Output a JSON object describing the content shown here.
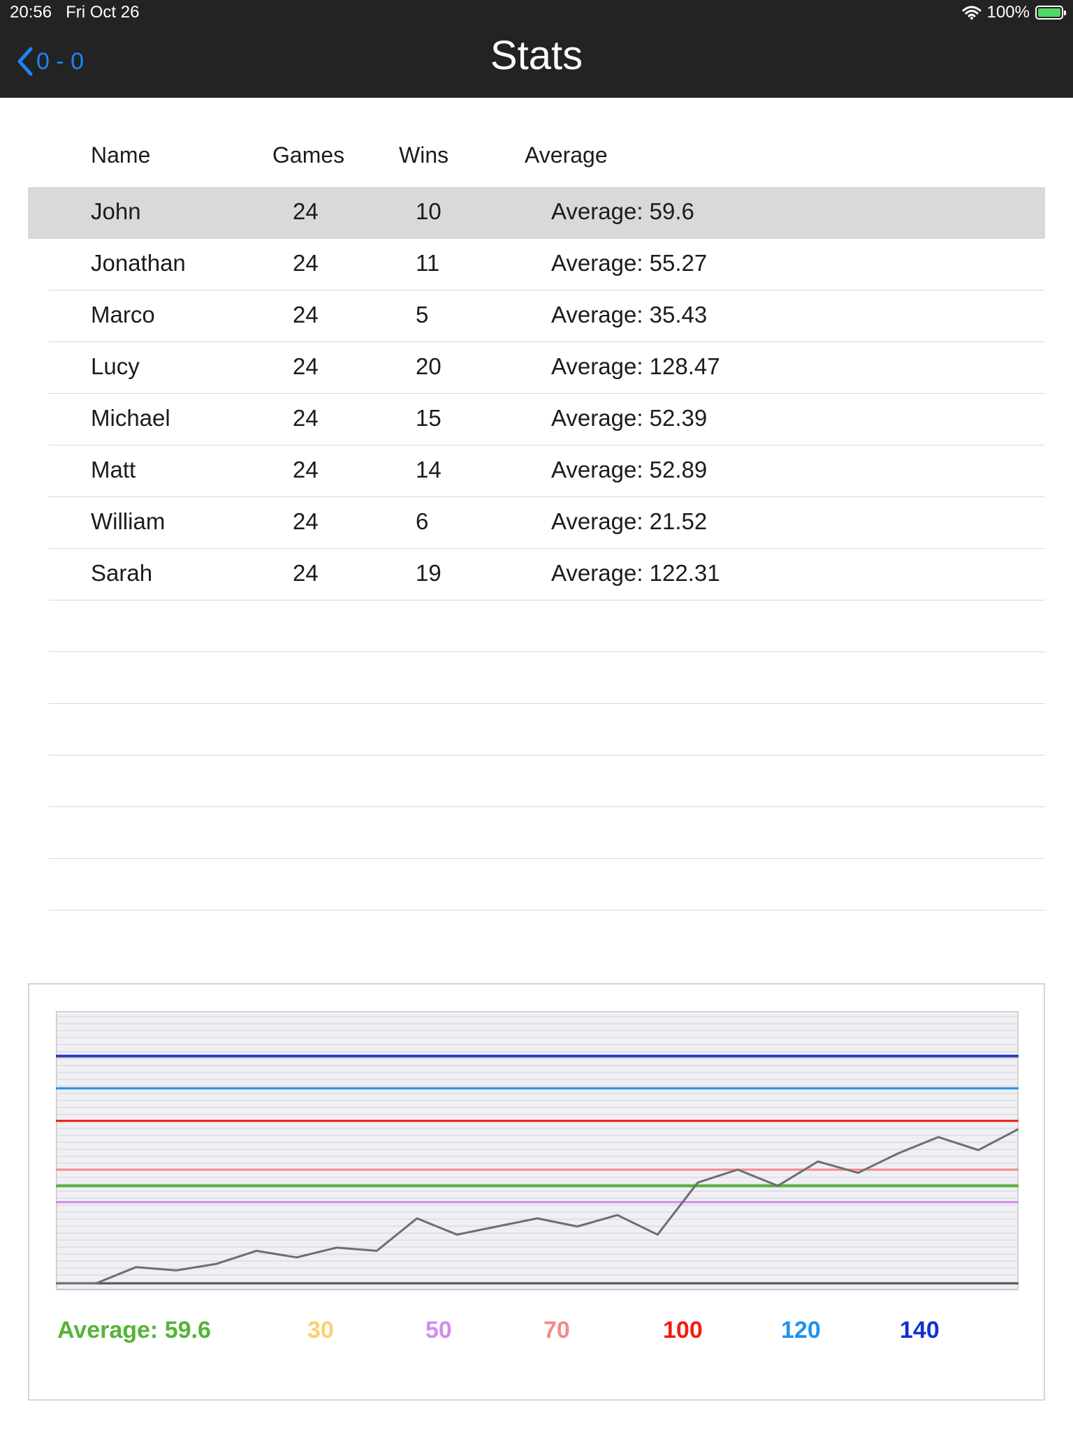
{
  "status_bar": {
    "time": "20:56",
    "date": "Fri Oct 26",
    "battery": "100%"
  },
  "nav": {
    "back_label": "0 - 0",
    "title": "Stats"
  },
  "table": {
    "headers": {
      "name": "Name",
      "games": "Games",
      "wins": "Wins",
      "average": "Average"
    },
    "rows": [
      {
        "name": "John",
        "games": "24",
        "wins": "10",
        "average": "Average: 59.6"
      },
      {
        "name": "Jonathan",
        "games": "24",
        "wins": "11",
        "average": "Average: 55.27"
      },
      {
        "name": "Marco",
        "games": "24",
        "wins": "5",
        "average": "Average: 35.43"
      },
      {
        "name": "Lucy",
        "games": "24",
        "wins": "20",
        "average": "Average: 128.47"
      },
      {
        "name": "Michael",
        "games": "24",
        "wins": "15",
        "average": "Average: 52.39"
      },
      {
        "name": "Matt",
        "games": "24",
        "wins": "14",
        "average": "Average: 52.89"
      },
      {
        "name": "William",
        "games": "24",
        "wins": "6",
        "average": "Average: 21.52"
      },
      {
        "name": "Sarah",
        "games": "24",
        "wins": "19",
        "average": "Average: 122.31"
      }
    ],
    "empty_rows": 6
  },
  "colors": {
    "accent": "#1a84ff",
    "average": "#55b33a",
    "30": "#ffcf72",
    "50": "#d28cf0",
    "70": "#f58a8a",
    "100": "#f01f0c",
    "120": "#1e92f2",
    "140": "#1230d4",
    "series_line": "#6e6e70"
  },
  "chart_data": {
    "type": "line",
    "ylim": [
      0,
      160
    ],
    "y_ref_lines": [
      {
        "value": 0,
        "color": "#55565a"
      },
      {
        "value": 50,
        "color": "#d28cf0"
      },
      {
        "value": 60,
        "color": "#55b33a"
      },
      {
        "value": 70,
        "color": "#f58a8a"
      },
      {
        "value": 100,
        "color": "#f01f0c"
      },
      {
        "value": 120,
        "color": "#1e92f2"
      },
      {
        "value": 140,
        "color": "#1230d4"
      }
    ],
    "grid": true,
    "series": [
      {
        "values": [
          0,
          0,
          10,
          8,
          12,
          20,
          16,
          22,
          20,
          40,
          30,
          35,
          40,
          35,
          42,
          30,
          62,
          70,
          60,
          75,
          68,
          80,
          90,
          82,
          95
        ]
      }
    ],
    "legend": [
      {
        "label": "Average: 59.6",
        "color": "#55b33a"
      },
      {
        "label": "30",
        "color": "#ffcf72"
      },
      {
        "label": "50",
        "color": "#d28cf0"
      },
      {
        "label": "70",
        "color": "#f58a8a"
      },
      {
        "label": "100",
        "color": "#f01f0c"
      },
      {
        "label": "120",
        "color": "#1e92f2"
      },
      {
        "label": "140",
        "color": "#1230d4"
      }
    ]
  }
}
